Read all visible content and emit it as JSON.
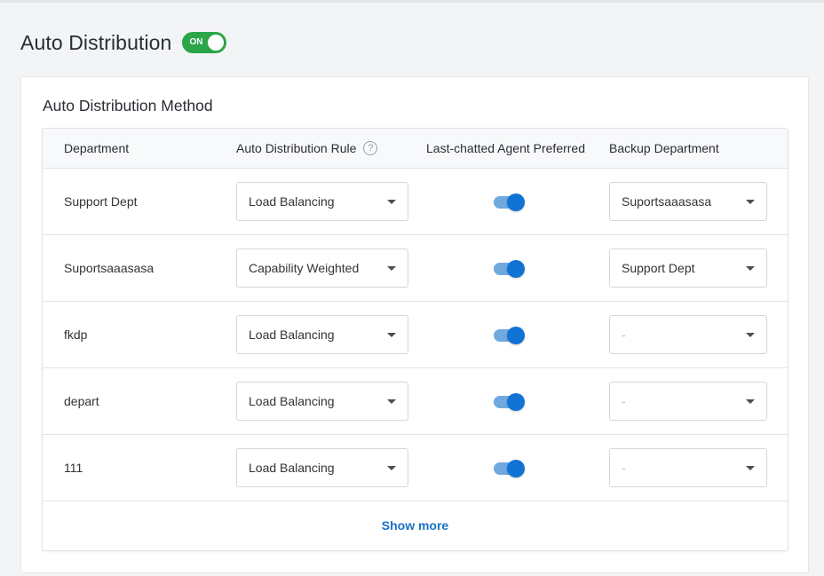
{
  "header": {
    "title": "Auto Distribution",
    "toggle_label": "ON",
    "toggle_state": "on",
    "toggle_color": "#2aa54a"
  },
  "section": {
    "title": "Auto Distribution Method"
  },
  "table": {
    "columns": [
      "Department",
      "Auto Distribution Rule",
      "Last-chatted Agent Preferred",
      "Backup Department"
    ],
    "rows": [
      {
        "department": "Support Dept",
        "rule": "Load Balancing",
        "agent_preferred": true,
        "backup": "Suportsaaasasa"
      },
      {
        "department": "Suportsaaasasa",
        "rule": "Capability Weighted",
        "agent_preferred": true,
        "backup": "Support Dept"
      },
      {
        "department": "fkdp",
        "rule": "Load Balancing",
        "agent_preferred": true,
        "backup": "-"
      },
      {
        "department": "depart",
        "rule": "Load Balancing",
        "agent_preferred": true,
        "backup": "-"
      },
      {
        "department": "111",
        "rule": "Load Balancing",
        "agent_preferred": true,
        "backup": "-"
      }
    ],
    "show_more_label": "Show more"
  },
  "icons": {
    "help": "help-circle-icon",
    "dropdown": "caret-down-icon"
  },
  "colors": {
    "accent_blue": "#1173d4",
    "link": "#1a73c7"
  }
}
